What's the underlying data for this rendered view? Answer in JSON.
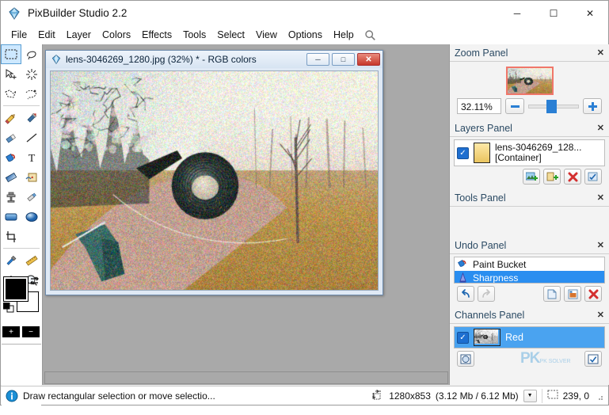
{
  "window": {
    "title": "PixBuilder Studio 2.2",
    "app_icon": "diamond-icon",
    "minimize": "─",
    "maximize": "☐",
    "close": "✕"
  },
  "menubar": {
    "items": [
      {
        "label": "File"
      },
      {
        "label": "Edit"
      },
      {
        "label": "Layer"
      },
      {
        "label": "Colors"
      },
      {
        "label": "Effects"
      },
      {
        "label": "Tools"
      },
      {
        "label": "Select"
      },
      {
        "label": "View"
      },
      {
        "label": "Options"
      },
      {
        "label": "Help"
      }
    ],
    "search_icon": "search-icon"
  },
  "toolbox": {
    "tools": [
      {
        "name": "rectangle-select-tool",
        "selected": true
      },
      {
        "name": "lasso-select-tool",
        "selected": false
      },
      {
        "name": "move-selection-tool",
        "selected": false
      },
      {
        "name": "magic-wand-tool",
        "selected": false
      },
      {
        "name": "polygon-select-tool",
        "selected": false
      },
      {
        "name": "freehand-select-tool",
        "selected": false
      },
      {
        "name": "pencil-tool",
        "selected": false
      },
      {
        "name": "paintbrush-tool",
        "selected": false
      },
      {
        "name": "eraser-tool",
        "selected": false
      },
      {
        "name": "line-tool",
        "selected": false
      },
      {
        "name": "paint-bucket-tool",
        "selected": false
      },
      {
        "name": "text-tool",
        "selected": false
      },
      {
        "name": "gradient-tool",
        "selected": false
      },
      {
        "name": "clone-stamp-tool",
        "selected": false
      },
      {
        "name": "stamp-tool",
        "selected": false
      },
      {
        "name": "blur-tool",
        "selected": false
      },
      {
        "name": "rectangle-shape-tool",
        "selected": false
      },
      {
        "name": "ellipse-shape-tool",
        "selected": false
      },
      {
        "name": "crop-tool",
        "selected": false
      },
      {
        "name": "color-picker-tool",
        "selected": false
      },
      {
        "name": "measure-tool",
        "selected": false
      },
      {
        "name": "hand-tool",
        "selected": false
      },
      {
        "name": "zoom-tool",
        "selected": false
      }
    ],
    "colors": {
      "foreground": "#000000",
      "background": "#ffffff",
      "swap_icon": "swap-colors-icon",
      "plus_label": "+",
      "minus_label": "−"
    }
  },
  "document": {
    "icon": "diamond-icon",
    "title": "lens-3046269_1280.jpg (32%) * - RGB colors",
    "minimize": "─",
    "restore": "□",
    "close": "✕"
  },
  "panels": {
    "zoom": {
      "title": "Zoom Panel",
      "close": "✕",
      "value": "32.11%",
      "minus_label": "−",
      "plus_label": "+",
      "slider_position_percent": 36
    },
    "layers": {
      "title": "Layers Panel",
      "close": "✕",
      "items": [
        {
          "name": "lens-3046269_128...",
          "subtitle": "[Container]",
          "visible": true,
          "check": "✓"
        }
      ],
      "buttons": [
        {
          "name": "add-image-layer-button"
        },
        {
          "name": "add-layer-button"
        },
        {
          "name": "delete-layer-button"
        },
        {
          "name": "layer-properties-button"
        }
      ]
    },
    "tools": {
      "title": "Tools Panel",
      "close": "✕"
    },
    "undo": {
      "title": "Undo Panel",
      "close": "✕",
      "items": [
        {
          "label": "Paint Bucket",
          "selected": false,
          "icon": "paint-bucket-icon"
        },
        {
          "label": "Sharpness",
          "selected": true,
          "icon": "sharpness-icon"
        }
      ],
      "undo_label": "↶",
      "redo_label": "↷",
      "buttons": [
        {
          "name": "new-snapshot-button"
        },
        {
          "name": "snapshot-image-button"
        },
        {
          "name": "delete-history-button"
        }
      ]
    },
    "channels": {
      "title": "Channels Panel",
      "close": "✕",
      "items": [
        {
          "label": "Red",
          "visible": true,
          "check": "✓",
          "selected": true
        }
      ],
      "load_selection_button": "load-channel-selection-button",
      "toggle_button": "channel-visibility-toggle",
      "watermark": "PK",
      "watermark_sub": "PK SOLVER"
    }
  },
  "statusbar": {
    "info_icon": "info-icon",
    "hint": "Draw rectangular selection or move selectio...",
    "size_icon": "image-size-icon",
    "dimensions": "1280x853",
    "memory": "(3.12 Mb / 6.12 Mb)",
    "dropdown": "▼",
    "selection_icon": "selection-icon",
    "coordinates": "239, 0"
  },
  "colors": {
    "accent": "#2a8ef0",
    "panel_title": "#2b4a63",
    "selection_blue": "#4aa3f0",
    "thumb_border": "#f0776a",
    "workarea": "#a9a9a9"
  }
}
